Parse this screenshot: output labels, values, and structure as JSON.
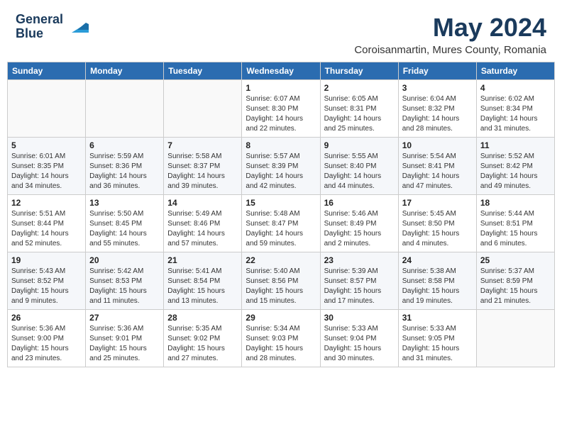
{
  "logo": {
    "line1": "General",
    "line2": "Blue"
  },
  "title": "May 2024",
  "subtitle": "Coroisanmartin, Mures County, Romania",
  "headers": [
    "Sunday",
    "Monday",
    "Tuesday",
    "Wednesday",
    "Thursday",
    "Friday",
    "Saturday"
  ],
  "weeks": [
    [
      {
        "day": "",
        "info": ""
      },
      {
        "day": "",
        "info": ""
      },
      {
        "day": "",
        "info": ""
      },
      {
        "day": "1",
        "info": "Sunrise: 6:07 AM\nSunset: 8:30 PM\nDaylight: 14 hours\nand 22 minutes."
      },
      {
        "day": "2",
        "info": "Sunrise: 6:05 AM\nSunset: 8:31 PM\nDaylight: 14 hours\nand 25 minutes."
      },
      {
        "day": "3",
        "info": "Sunrise: 6:04 AM\nSunset: 8:32 PM\nDaylight: 14 hours\nand 28 minutes."
      },
      {
        "day": "4",
        "info": "Sunrise: 6:02 AM\nSunset: 8:34 PM\nDaylight: 14 hours\nand 31 minutes."
      }
    ],
    [
      {
        "day": "5",
        "info": "Sunrise: 6:01 AM\nSunset: 8:35 PM\nDaylight: 14 hours\nand 34 minutes."
      },
      {
        "day": "6",
        "info": "Sunrise: 5:59 AM\nSunset: 8:36 PM\nDaylight: 14 hours\nand 36 minutes."
      },
      {
        "day": "7",
        "info": "Sunrise: 5:58 AM\nSunset: 8:37 PM\nDaylight: 14 hours\nand 39 minutes."
      },
      {
        "day": "8",
        "info": "Sunrise: 5:57 AM\nSunset: 8:39 PM\nDaylight: 14 hours\nand 42 minutes."
      },
      {
        "day": "9",
        "info": "Sunrise: 5:55 AM\nSunset: 8:40 PM\nDaylight: 14 hours\nand 44 minutes."
      },
      {
        "day": "10",
        "info": "Sunrise: 5:54 AM\nSunset: 8:41 PM\nDaylight: 14 hours\nand 47 minutes."
      },
      {
        "day": "11",
        "info": "Sunrise: 5:52 AM\nSunset: 8:42 PM\nDaylight: 14 hours\nand 49 minutes."
      }
    ],
    [
      {
        "day": "12",
        "info": "Sunrise: 5:51 AM\nSunset: 8:44 PM\nDaylight: 14 hours\nand 52 minutes."
      },
      {
        "day": "13",
        "info": "Sunrise: 5:50 AM\nSunset: 8:45 PM\nDaylight: 14 hours\nand 55 minutes."
      },
      {
        "day": "14",
        "info": "Sunrise: 5:49 AM\nSunset: 8:46 PM\nDaylight: 14 hours\nand 57 minutes."
      },
      {
        "day": "15",
        "info": "Sunrise: 5:48 AM\nSunset: 8:47 PM\nDaylight: 14 hours\nand 59 minutes."
      },
      {
        "day": "16",
        "info": "Sunrise: 5:46 AM\nSunset: 8:49 PM\nDaylight: 15 hours\nand 2 minutes."
      },
      {
        "day": "17",
        "info": "Sunrise: 5:45 AM\nSunset: 8:50 PM\nDaylight: 15 hours\nand 4 minutes."
      },
      {
        "day": "18",
        "info": "Sunrise: 5:44 AM\nSunset: 8:51 PM\nDaylight: 15 hours\nand 6 minutes."
      }
    ],
    [
      {
        "day": "19",
        "info": "Sunrise: 5:43 AM\nSunset: 8:52 PM\nDaylight: 15 hours\nand 9 minutes."
      },
      {
        "day": "20",
        "info": "Sunrise: 5:42 AM\nSunset: 8:53 PM\nDaylight: 15 hours\nand 11 minutes."
      },
      {
        "day": "21",
        "info": "Sunrise: 5:41 AM\nSunset: 8:54 PM\nDaylight: 15 hours\nand 13 minutes."
      },
      {
        "day": "22",
        "info": "Sunrise: 5:40 AM\nSunset: 8:56 PM\nDaylight: 15 hours\nand 15 minutes."
      },
      {
        "day": "23",
        "info": "Sunrise: 5:39 AM\nSunset: 8:57 PM\nDaylight: 15 hours\nand 17 minutes."
      },
      {
        "day": "24",
        "info": "Sunrise: 5:38 AM\nSunset: 8:58 PM\nDaylight: 15 hours\nand 19 minutes."
      },
      {
        "day": "25",
        "info": "Sunrise: 5:37 AM\nSunset: 8:59 PM\nDaylight: 15 hours\nand 21 minutes."
      }
    ],
    [
      {
        "day": "26",
        "info": "Sunrise: 5:36 AM\nSunset: 9:00 PM\nDaylight: 15 hours\nand 23 minutes."
      },
      {
        "day": "27",
        "info": "Sunrise: 5:36 AM\nSunset: 9:01 PM\nDaylight: 15 hours\nand 25 minutes."
      },
      {
        "day": "28",
        "info": "Sunrise: 5:35 AM\nSunset: 9:02 PM\nDaylight: 15 hours\nand 27 minutes."
      },
      {
        "day": "29",
        "info": "Sunrise: 5:34 AM\nSunset: 9:03 PM\nDaylight: 15 hours\nand 28 minutes."
      },
      {
        "day": "30",
        "info": "Sunrise: 5:33 AM\nSunset: 9:04 PM\nDaylight: 15 hours\nand 30 minutes."
      },
      {
        "day": "31",
        "info": "Sunrise: 5:33 AM\nSunset: 9:05 PM\nDaylight: 15 hours\nand 31 minutes."
      },
      {
        "day": "",
        "info": ""
      }
    ]
  ],
  "colors": {
    "header_bg": "#2b6cb0",
    "header_text": "#ffffff",
    "title_color": "#1a3a5c"
  }
}
